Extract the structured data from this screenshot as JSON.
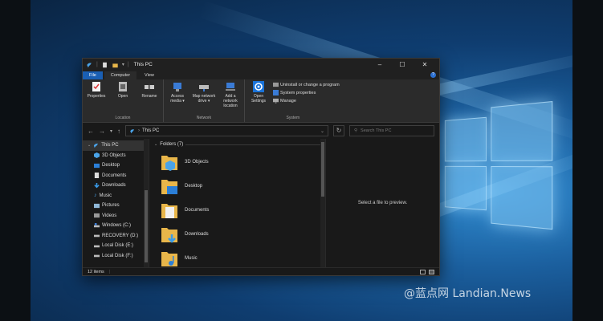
{
  "window": {
    "title": "This PC",
    "controls": [
      "–",
      "☐",
      "✕"
    ]
  },
  "ribbon": {
    "tabs": [
      {
        "label": "File"
      },
      {
        "label": "Computer"
      },
      {
        "label": "View"
      }
    ],
    "help": "?",
    "groups": [
      {
        "name": "Location",
        "buttons": [
          {
            "label": "Properties"
          },
          {
            "label": "Open"
          },
          {
            "label": "Rename"
          }
        ]
      },
      {
        "name": "Network",
        "buttons": [
          {
            "label": "Access media ▾"
          },
          {
            "label": "Map network drive ▾"
          },
          {
            "label": "Add a network location"
          }
        ]
      },
      {
        "name": "System",
        "open_settings": "Open Settings",
        "items": [
          {
            "label": "Uninstall or change a program"
          },
          {
            "label": "System properties"
          },
          {
            "label": "Manage"
          }
        ]
      }
    ]
  },
  "address": {
    "path": "This PC",
    "search_placeholder": "Search This PC"
  },
  "navpane": {
    "items": [
      {
        "label": "This PC",
        "icon": "pc-icon"
      },
      {
        "label": "3D Objects",
        "icon": "3d-objects-icon"
      },
      {
        "label": "Desktop",
        "icon": "desktop-icon"
      },
      {
        "label": "Documents",
        "icon": "documents-icon"
      },
      {
        "label": "Downloads",
        "icon": "downloads-icon"
      },
      {
        "label": "Music",
        "icon": "music-icon"
      },
      {
        "label": "Pictures",
        "icon": "pictures-icon"
      },
      {
        "label": "Videos",
        "icon": "videos-icon"
      },
      {
        "label": "Windows (C:)",
        "icon": "drive-icon"
      },
      {
        "label": "RECOVERY (D:)",
        "icon": "drive-icon"
      },
      {
        "label": "Local Disk (E:)",
        "icon": "drive-icon"
      },
      {
        "label": "Local Disk (F:)",
        "icon": "drive-icon"
      }
    ]
  },
  "files": {
    "group_header": "Folders (7)",
    "folders": [
      {
        "name": "3D Objects",
        "icon": "3d-objects-folder-icon"
      },
      {
        "name": "Desktop",
        "icon": "desktop-folder-icon"
      },
      {
        "name": "Documents",
        "icon": "documents-folder-icon"
      },
      {
        "name": "Downloads",
        "icon": "downloads-folder-icon"
      },
      {
        "name": "Music",
        "icon": "music-folder-icon"
      }
    ]
  },
  "preview": {
    "text": "Select a file to preview."
  },
  "status": {
    "count": "12 items",
    "separator": "|"
  },
  "watermark": {
    "text": "@蓝点网 Landian.News"
  },
  "colors": {
    "accent": "#1a5fb4",
    "window_bg": "#191919",
    "ribbon_bg": "#2b2b2b",
    "folder": "#e8b64a"
  }
}
